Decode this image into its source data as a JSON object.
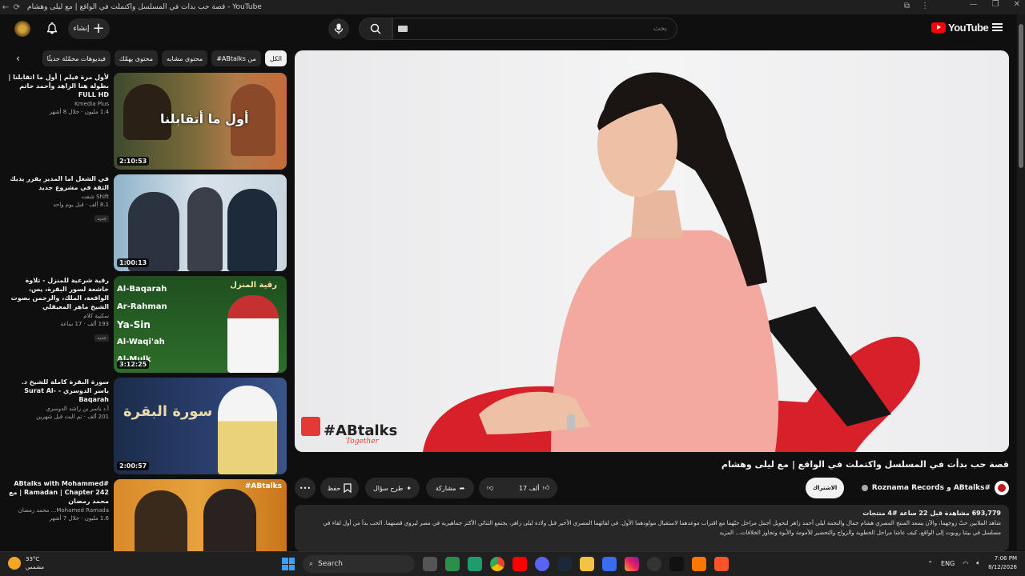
{
  "browser": {
    "tab_title": "قصة حب بدأت في المسلسل واكتملت في الواقع | مع ليلى وهشام - YouTube"
  },
  "header": {
    "create_label": "إنشاء",
    "search_placeholder": "بحث",
    "logo_text": "YouTube"
  },
  "chips": [
    {
      "label": "الكل",
      "active": true
    },
    {
      "label": "من ABtalks#",
      "active": false
    },
    {
      "label": "محتوى مشابه",
      "active": false
    },
    {
      "label": "محتوى يهمّك",
      "active": false
    },
    {
      "label": "فيديوهات محمّلة حديثًا",
      "active": false
    }
  ],
  "recommendations": [
    {
      "title": "لأول مرة فيلم | أول ما اتقابلنا | بطولة هنا الزاهد وأحمد حاتم FULL HD",
      "channel": "Kmedia Plus",
      "stats": "1.4 مليون · خلال 8 أشهر",
      "duration": "2:10:53",
      "thumb_text": "أول ما أتقابلنا",
      "new": ""
    },
    {
      "title": "في الشغل اما المدير يقرر يديك الثقة في مشروع جديد",
      "channel": "Shift شفت",
      "stats": "8.1 ألف · قبل يوم واحد",
      "duration": "1:00:13",
      "thumb_text": "",
      "new": "جديد"
    },
    {
      "title": "رقية شرعية للمنزل - تلاوة خاشعة لسور البقرة، يس، الواقعة، الملك، والرحمن بصوت الشيخ ماهر المعيقلي",
      "channel": "سكينة كلام",
      "stats": "193 ألف · 17 ساعة",
      "duration": "3:12:25",
      "thumb_text": "رقية المنزل",
      "surahs": [
        "Al-Baqarah",
        "Ar-Rahman",
        "Ya-Sin",
        "Al-Waqi'ah",
        "Al-Mulk"
      ],
      "new": "جديد"
    },
    {
      "title": "سورة البقرة كاملة للشيخ د. ياسر الدوسري - Surat Al-Baqarah",
      "channel": "أ.د ياسر بن راشد الدوسري",
      "stats": "201 ألف · تم البث قبل شهرين",
      "duration": "2:00:57",
      "thumb_text": "سورة البقرة",
      "new": ""
    },
    {
      "title": "#ABtalks with Mohammed Ramadan | Chapter 242 | مع محمد رمضان",
      "channel": "Mohamed Ramada... محمد رمضان",
      "stats": "1.6 مليون · خلال 7 أشهر",
      "duration": "",
      "thumb_text": "#ABtalks",
      "new": ""
    }
  ],
  "video": {
    "title": "قصة حب بدأت في المسلسل واكتملت في الواقع | مع ليلى وهشام",
    "watermark": "#ABtalks",
    "watermark_sub": "Together",
    "owner_text": "#ABtalks و Roznama Records",
    "subscribe_label": "الاشتراك",
    "likes": "17 ألف",
    "share_label": "مشاركة",
    "ask_label": "طرح سؤال",
    "save_label": "حفظ",
    "stats_line": "693,779 مشاهدة قبل 22 ساعة #4 منتجات",
    "description": "شاهد الملايين حبّ زوجهما، والآن يسعد المنتج المصري هشام جمال والنجمة ليلى أحمد زاهر لتحويل أجمل مراحل حبّهما مع اقتراب موعدهما لاستقبال مولودهما الأول. في لقائهما المصري الأخير قبل ولادة ليلى زاهر، يجتمع الثنائي الأكثر جماهيرية في مصر ليروي قصتهما. الحب بدأ من أول لقاء في مسلسل في بيتنا روبوت إلى الواقع، كيف عاشا مراحل الخطوبة والزواج والتحضير للأمومة والأبوة وتجاوز الخلافات... المزيد"
  },
  "taskbar": {
    "temperature": "33°C",
    "weather": "مشمس",
    "search_label": "Search",
    "lang": "ENG",
    "time": "7:06 PM",
    "date": "8/12/2026"
  },
  "colors": {
    "accent_red": "#ff0000",
    "bg": "#0f0f0f",
    "chip_bg": "#272727"
  }
}
